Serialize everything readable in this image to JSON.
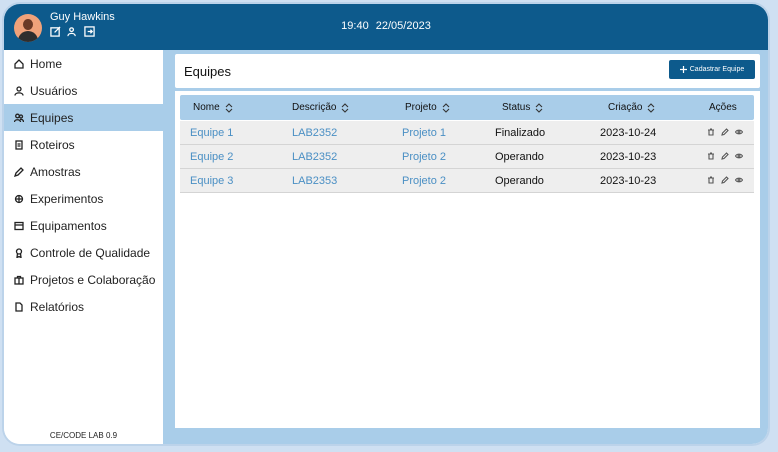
{
  "user": {
    "name": "Guy Hawkins"
  },
  "datetime": {
    "time": "19:40",
    "date": "22/05/2023"
  },
  "sidebar": {
    "items": [
      {
        "label": "Home",
        "icon": "home-icon"
      },
      {
        "label": "Usuários",
        "icon": "user-icon"
      },
      {
        "label": "Equipes",
        "icon": "users-icon",
        "active": true
      },
      {
        "label": "Roteiros",
        "icon": "document-icon"
      },
      {
        "label": "Amostras",
        "icon": "pencil-icon"
      },
      {
        "label": "Experimentos",
        "icon": "flask-icon"
      },
      {
        "label": "Equipamentos",
        "icon": "equipment-icon"
      },
      {
        "label": "Controle de Qualidade",
        "icon": "badge-icon"
      },
      {
        "label": "Projetos e Colaboração",
        "icon": "briefcase-icon"
      },
      {
        "label": "Relatórios",
        "icon": "file-icon"
      }
    ],
    "version": "CE/CODE LAB 0.9"
  },
  "page": {
    "title": "Equipes",
    "add_button": "Cadastrar Equipe"
  },
  "table": {
    "columns": [
      "Nome",
      "Descrição",
      "Projeto",
      "Status",
      "Criação",
      "Ações"
    ],
    "rows": [
      {
        "nome": "Equipe 1",
        "descricao": "LAB2352",
        "projeto": "Projeto 1",
        "status": "Finalizado",
        "criacao": "2023-10-24"
      },
      {
        "nome": "Equipe 2",
        "descricao": "LAB2352",
        "projeto": "Projeto 2",
        "status": "Operando",
        "criacao": "2023-10-23"
      },
      {
        "nome": "Equipe 3",
        "descricao": "LAB2353",
        "projeto": "Projeto 2",
        "status": "Operando",
        "criacao": "2023-10-23"
      }
    ]
  },
  "colors": {
    "topbar": "#0d5a8c",
    "accent_light": "#a9cde9",
    "link": "#4a8fc4"
  }
}
